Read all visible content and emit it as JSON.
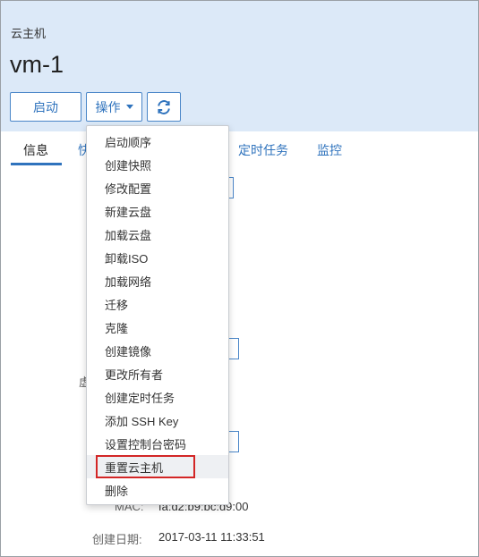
{
  "breadcrumb": "云主机",
  "page_title": "vm-1",
  "buttons": {
    "start": "启动",
    "operations": "操作",
    "refresh_icon": "refresh-icon"
  },
  "tabs": [
    {
      "label": "信息"
    },
    {
      "label": "快"
    },
    {
      "label": "定时任务"
    },
    {
      "label": "监控"
    }
  ],
  "background": {
    "partial_label": "虚",
    "mac_label": "MAC:",
    "mac_value": "fa:d2:b9:bc:d9:00",
    "created_label": "创建日期:",
    "created_value": "2017-03-11 11:33:51"
  },
  "menu": {
    "items": [
      "启动顺序",
      "创建快照",
      "修改配置",
      "新建云盘",
      "加载云盘",
      "卸载ISO",
      "加载网络",
      "迁移",
      "克隆",
      "创建镜像",
      "更改所有者",
      "创建定时任务",
      "添加 SSH Key",
      "设置控制台密码",
      "重置云主机",
      "删除"
    ],
    "highlighted_index": 14
  },
  "colors": {
    "header_bg": "#dce9f8",
    "accent": "#2f73bd",
    "highlight_border": "#d32626"
  }
}
